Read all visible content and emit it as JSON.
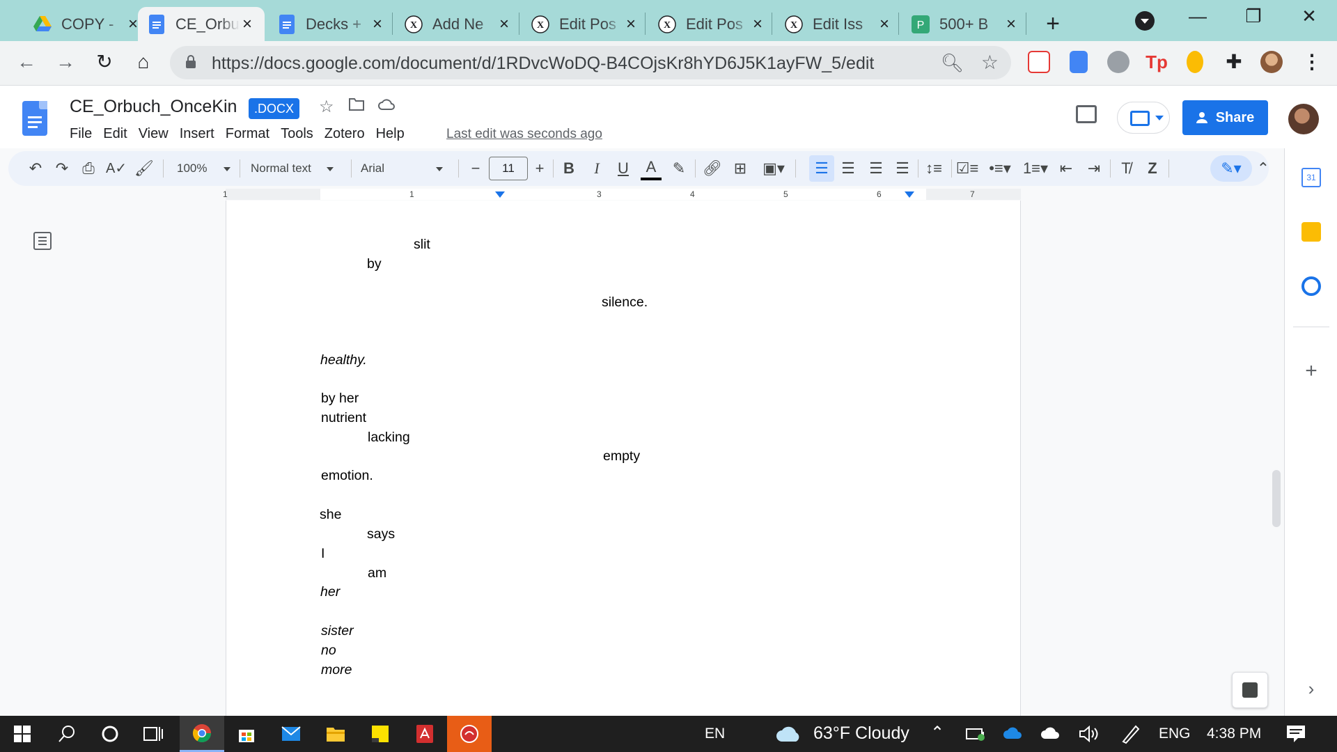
{
  "browser": {
    "tabs": [
      {
        "title": "COPY -",
        "icon": "google-drive-icon",
        "active": false
      },
      {
        "title": "CE_Orbuch",
        "icon": "google-docs-icon",
        "active": true
      },
      {
        "title": "Decks +",
        "icon": "google-slides-icon",
        "active": false
      },
      {
        "title": "Add Ne",
        "icon": "site-x-icon",
        "active": false
      },
      {
        "title": "Edit Pos",
        "icon": "site-x-icon",
        "active": false
      },
      {
        "title": "Edit Pos",
        "icon": "site-x-icon",
        "active": false
      },
      {
        "title": "Edit Iss",
        "icon": "site-x-icon",
        "active": false
      },
      {
        "title": "500+ B",
        "icon": "generic-p-icon",
        "active": false
      }
    ],
    "url": "https://docs.google.com/document/d/1RDvcWoDQ-B4COjsKr8hYD6J5K1ayFW_5/edit"
  },
  "docs": {
    "title": "CE_Orbuch_OnceKin",
    "badge": ".DOCX",
    "menu": [
      "File",
      "Edit",
      "View",
      "Insert",
      "Format",
      "Tools",
      "Zotero",
      "Help"
    ],
    "last_edit": "Last edit was seconds ago",
    "share_label": "Share",
    "accent": "#1a73e8"
  },
  "toolbar": {
    "zoom": "100%",
    "style": "Normal text",
    "font": "Arial",
    "font_size": "11"
  },
  "ruler": {
    "numbers": [
      "1",
      "1",
      "2",
      "3",
      "4",
      "5",
      "6",
      "7"
    ]
  },
  "document": {
    "lines": [
      {
        "text": "slit",
        "italic": false
      },
      {
        "text": "by",
        "italic": false
      },
      {
        "text": "silence.",
        "italic": false
      },
      {
        "text": "healthy.",
        "italic": true
      },
      {
        "text": "by her",
        "italic": false
      },
      {
        "text": "nutrient",
        "italic": false
      },
      {
        "text": "lacking",
        "italic": false
      },
      {
        "text": "empty",
        "italic": false
      },
      {
        "text": "emotion.",
        "italic": false
      },
      {
        "text": "she",
        "italic": false
      },
      {
        "text": "says",
        "italic": false
      },
      {
        "text": "I",
        "italic": false
      },
      {
        "text": "am",
        "italic": false
      },
      {
        "text": "her",
        "italic": true
      },
      {
        "text": "sister",
        "italic": true
      },
      {
        "text": "no",
        "italic": true
      },
      {
        "text": "more",
        "italic": true
      }
    ]
  },
  "taskbar": {
    "language_short": "EN",
    "weather": "63°F  Cloudy",
    "language": "ENG",
    "time": "4:38 PM"
  }
}
